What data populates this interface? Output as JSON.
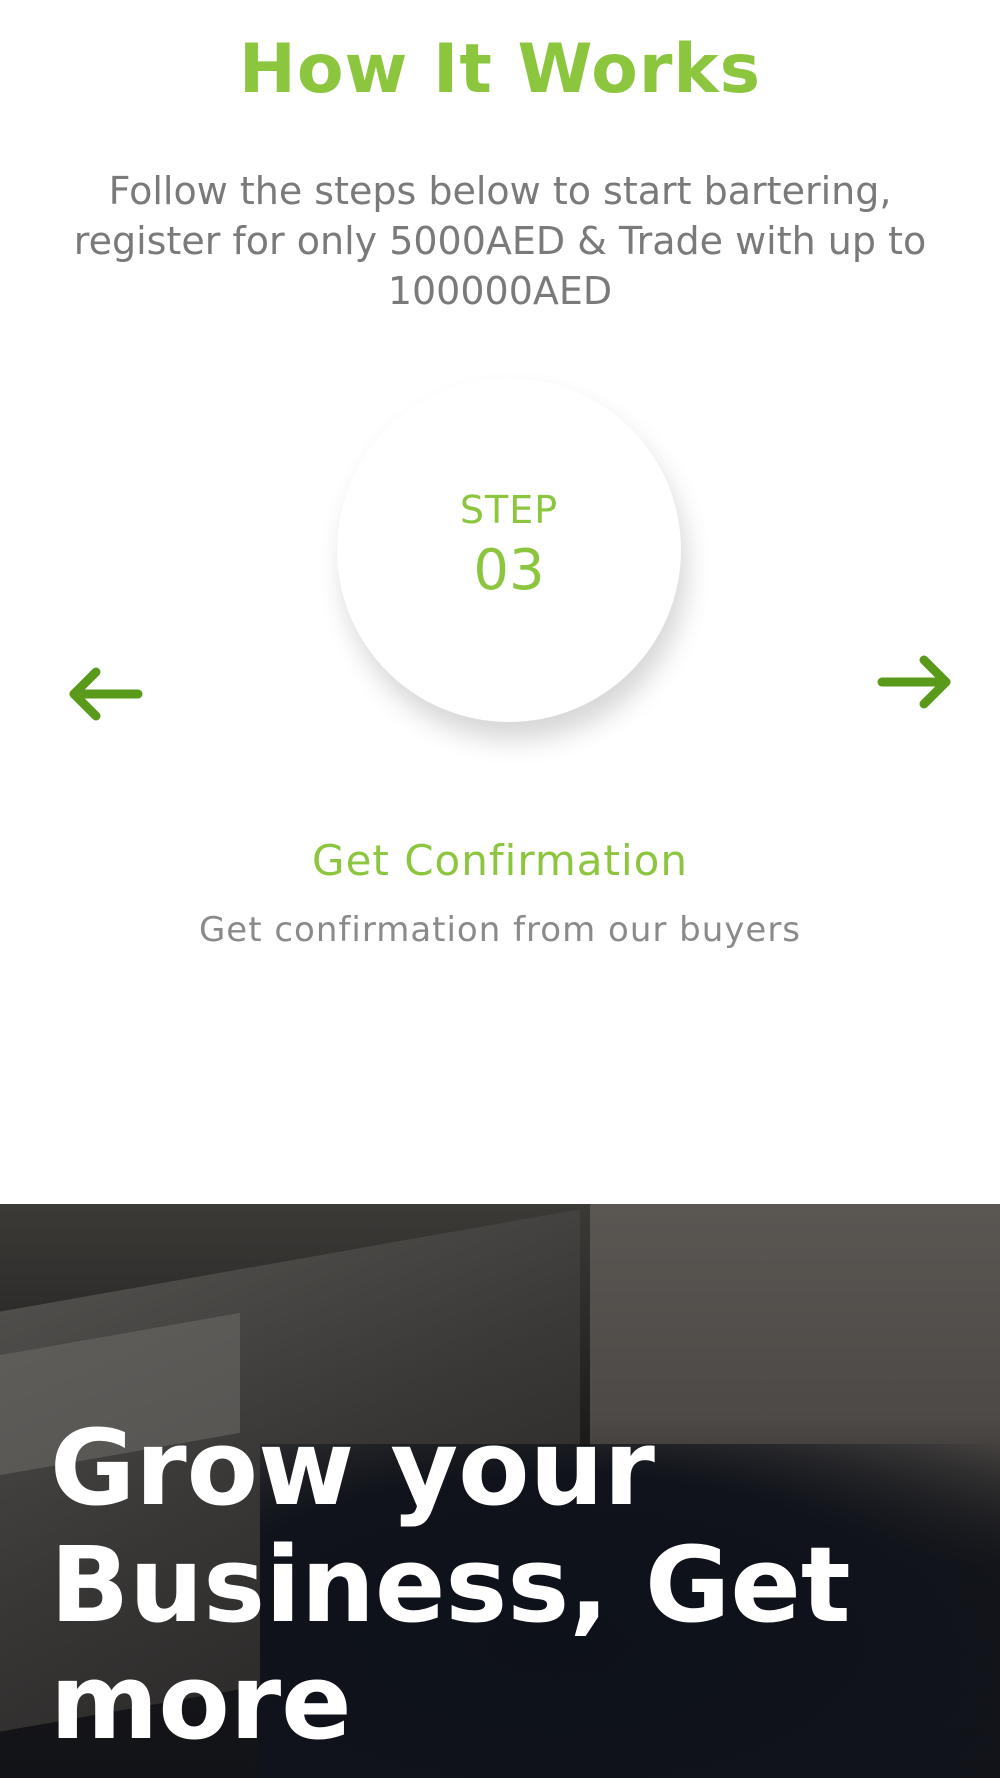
{
  "how_it_works": {
    "title": "How It Works",
    "subtitle": "Follow the steps below to start bartering, register for only 5000AED & Trade with up to 100000AED",
    "step": {
      "label": "STEP",
      "number": "03",
      "title": "Get Confirmation",
      "description": "Get confirmation from our buyers"
    },
    "navigation": {
      "prev_icon": "arrow-left-icon",
      "next_icon": "arrow-right-icon"
    }
  },
  "hero": {
    "title": "Grow your Business, Get more"
  },
  "colors": {
    "accent": "#8cc63f",
    "arrow": "#5a9a1a",
    "muted_text": "#7a7a7a",
    "hero_text": "#ffffff"
  }
}
